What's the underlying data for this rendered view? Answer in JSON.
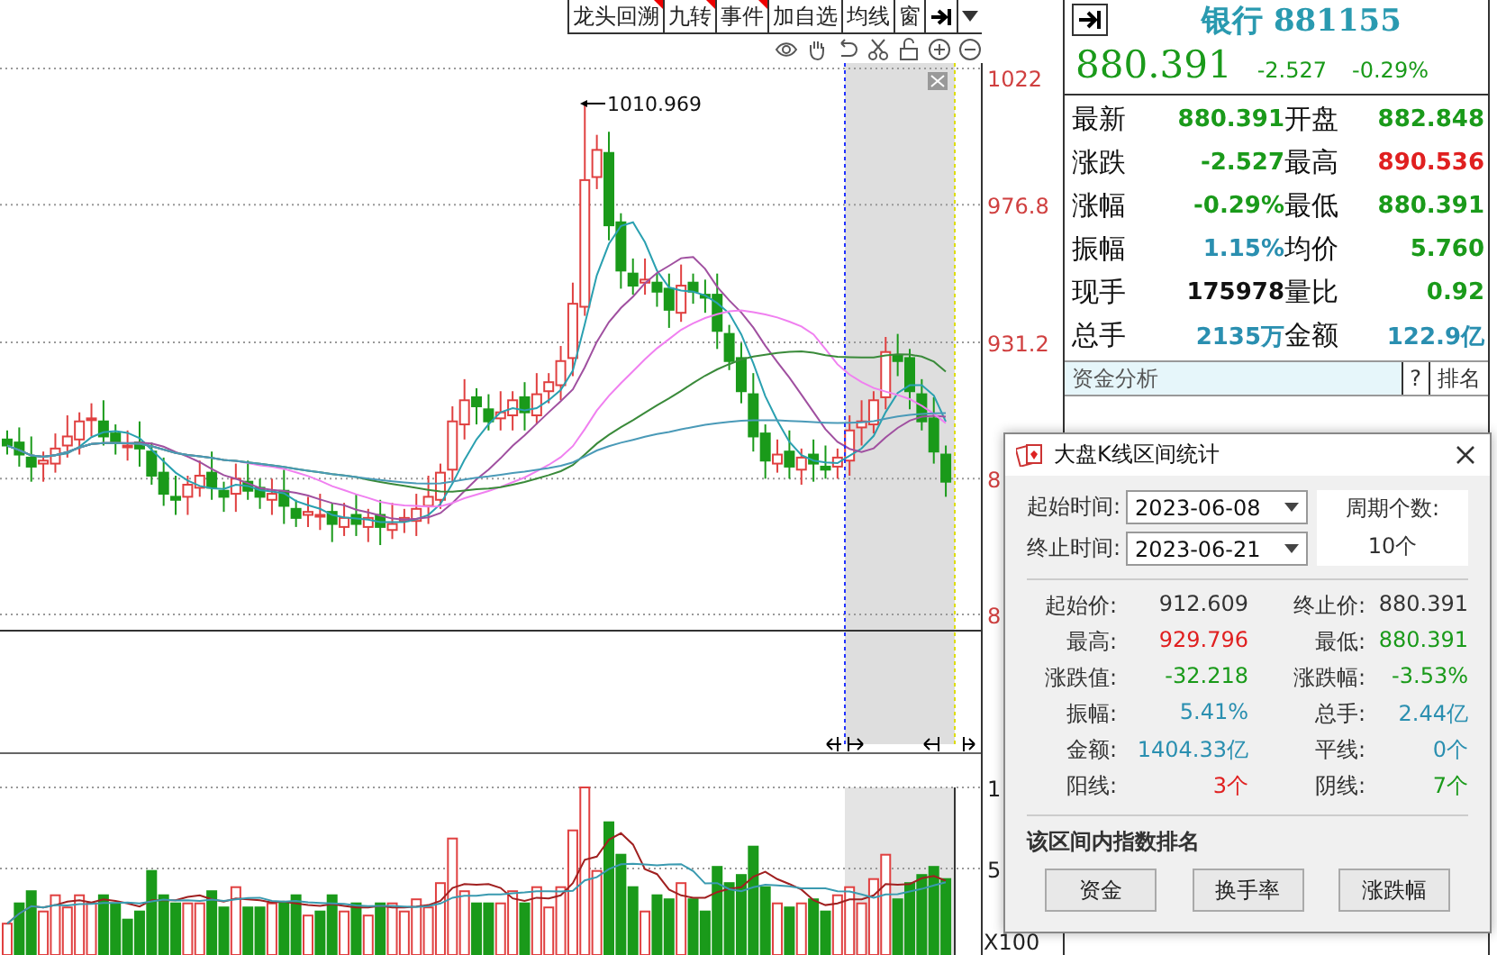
{
  "toolbar": {
    "buttons": [
      {
        "label": "龙头回溯",
        "flagged": true
      },
      {
        "label": "九转",
        "flagged": true
      },
      {
        "label": "事件",
        "flagged": true
      },
      {
        "label": "加自选",
        "flagged": false
      },
      {
        "label": "均线",
        "flagged": false
      },
      {
        "label": "窗",
        "flagged": false
      }
    ]
  },
  "price_chart": {
    "axis_labels": [
      "1022",
      "976.8",
      "931.2",
      "8",
      "8"
    ],
    "peak_label": "1010.969"
  },
  "volume_chart": {
    "axis_labels": [
      "1",
      "5"
    ],
    "unit": "X100"
  },
  "quote": {
    "title": "银行 881155",
    "price": "880.391",
    "change": "-2.527",
    "change_pct": "-0.29%",
    "rows": [
      [
        {
          "label": "最新",
          "value": "880.391",
          "color": "#1a9a1a"
        },
        {
          "label": "开盘",
          "value": "882.848",
          "color": "#1a9a1a"
        }
      ],
      [
        {
          "label": "涨跌",
          "value": "-2.527",
          "color": "#1a9a1a"
        },
        {
          "label": "最高",
          "value": "890.536",
          "color": "#e02020"
        }
      ],
      [
        {
          "label": "涨幅",
          "value": "-0.29%",
          "color": "#1a9a1a"
        },
        {
          "label": "最低",
          "value": "880.391",
          "color": "#1a9a1a"
        }
      ],
      [
        {
          "label": "振幅",
          "value": "1.15%",
          "color": "#2a8fb0"
        },
        {
          "label": "均价",
          "value": "5.760",
          "color": "#1a9a1a"
        }
      ],
      [
        {
          "label": "现手",
          "value": "175978",
          "color": "#111111"
        },
        {
          "label": "量比",
          "value": "0.92",
          "color": "#1a9a1a"
        }
      ],
      [
        {
          "label": "总手",
          "value": "2135万",
          "color": "#2a8fb0"
        },
        {
          "label": "金额",
          "value": "122.9亿",
          "color": "#2a8fb0"
        }
      ]
    ]
  },
  "funds_bar": {
    "title": "资金分析",
    "help": "?",
    "rank": "排名"
  },
  "dialog": {
    "title": "大盘K线区间统计",
    "start_label": "起始时间:",
    "start_value": "2023-06-08",
    "end_label": "终止时间:",
    "end_value": "2023-06-21",
    "period_label": "周期个数:",
    "period_value": "10个",
    "stats": [
      {
        "label": "起始价:",
        "value": "912.609",
        "color": "#333333"
      },
      {
        "label": "终止价:",
        "value": "880.391",
        "color": "#333333"
      },
      {
        "label": "最高:",
        "value": "929.796",
        "color": "#e02020"
      },
      {
        "label": "最低:",
        "value": "880.391",
        "color": "#1a9a1a"
      },
      {
        "label": "涨跌值:",
        "value": "-32.218",
        "color": "#1a9a1a"
      },
      {
        "label": "涨跌幅:",
        "value": "-3.53%",
        "color": "#1a9a1a"
      },
      {
        "label": "振幅:",
        "value": "5.41%",
        "color": "#2a8fb0"
      },
      {
        "label": "总手:",
        "value": "2.44亿",
        "color": "#2a8fb0"
      },
      {
        "label": "金额:",
        "value": "1404.33亿",
        "color": "#2a8fb0"
      },
      {
        "label": "平线:",
        "value": "0个",
        "color": "#2a8fb0"
      },
      {
        "label": "阳线:",
        "value": "3个",
        "color": "#e02020"
      },
      {
        "label": "阴线:",
        "value": "7个",
        "color": "#1a9a1a"
      }
    ],
    "section_title": "该区间内指数排名",
    "buttons": [
      "资金",
      "换手率",
      "涨跌幅"
    ]
  }
}
